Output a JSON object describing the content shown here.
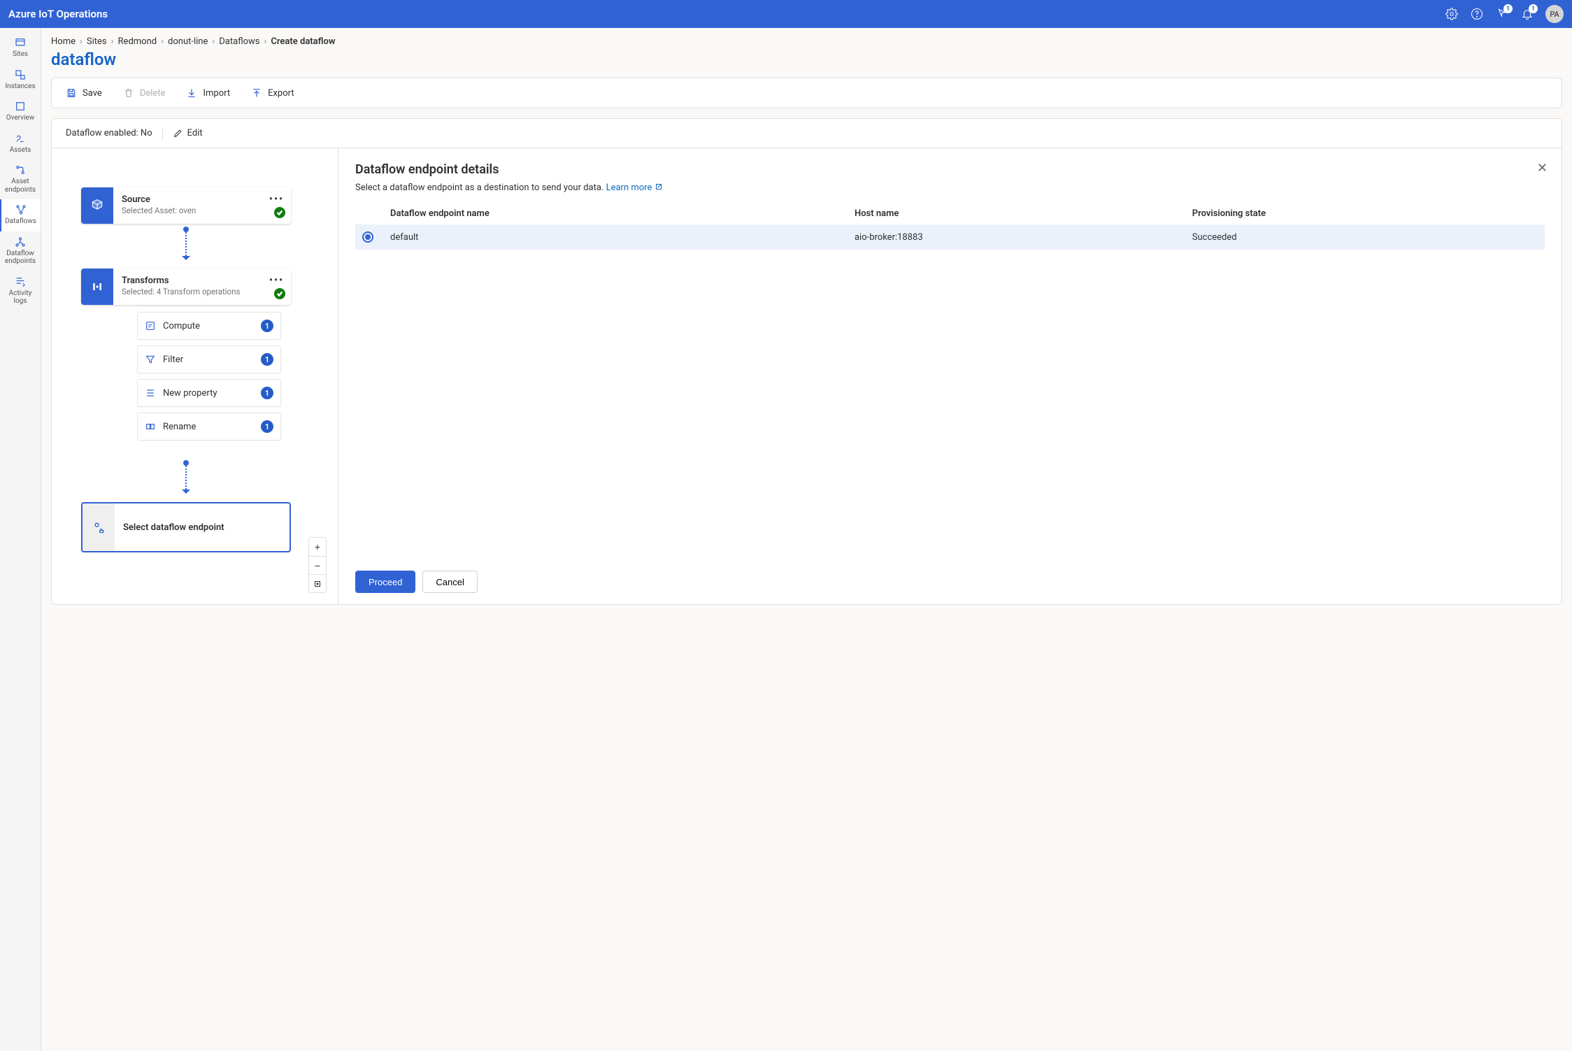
{
  "brand": "Azure IoT Operations",
  "badges": {
    "events": "1",
    "alerts": "1"
  },
  "avatar": "PA",
  "nav": {
    "sites": "Sites",
    "instances": "Instances",
    "overview": "Overview",
    "assets": "Assets",
    "asset_endpoints": "Asset endpoints",
    "dataflows": "Dataflows",
    "dataflow_endpoints": "Dataflow endpoints",
    "activity_logs": "Activity logs"
  },
  "breadcrumb": {
    "home": "Home",
    "sites": "Sites",
    "redmond": "Redmond",
    "donut": "donut-line",
    "dataflows": "Dataflows",
    "current": "Create dataflow"
  },
  "page_title": "dataflow",
  "toolbar": {
    "save": "Save",
    "delete": "Delete",
    "import": "Import",
    "export": "Export"
  },
  "status": {
    "label": "Dataflow enabled: No",
    "edit": "Edit"
  },
  "nodes": {
    "source": {
      "title": "Source",
      "sub": "Selected Asset: oven"
    },
    "transforms": {
      "title": "Transforms",
      "sub": "Selected: 4 Transform operations"
    },
    "dest": {
      "label": "Select dataflow endpoint"
    }
  },
  "ops": {
    "compute": {
      "label": "Compute",
      "count": "1"
    },
    "filter": {
      "label": "Filter",
      "count": "1"
    },
    "newprop": {
      "label": "New property",
      "count": "1"
    },
    "rename": {
      "label": "Rename",
      "count": "1"
    }
  },
  "details": {
    "title": "Dataflow endpoint details",
    "desc": "Select a dataflow endpoint as a destination to send your data. ",
    "learn_more": "Learn more",
    "cols": {
      "name": "Dataflow endpoint name",
      "host": "Host name",
      "state": "Provisioning state"
    },
    "row": {
      "name": "default",
      "host": "aio-broker:18883",
      "state": "Succeeded"
    },
    "proceed": "Proceed",
    "cancel": "Cancel"
  }
}
